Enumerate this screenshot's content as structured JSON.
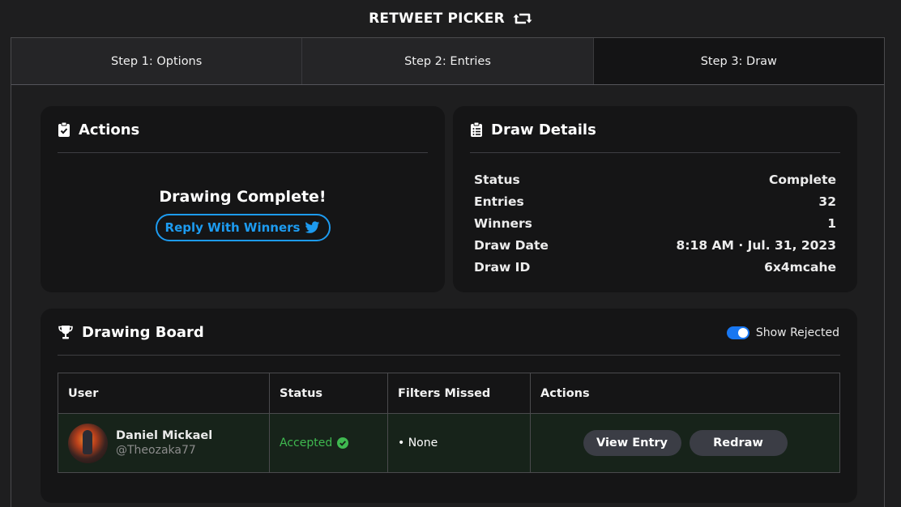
{
  "app": {
    "title": "RETWEET PICKER"
  },
  "steps": [
    {
      "label": "Step 1: Options"
    },
    {
      "label": "Step 2: Entries"
    },
    {
      "label": "Step 3: Draw"
    }
  ],
  "actions_card": {
    "title": "Actions",
    "message": "Drawing Complete!",
    "reply_button": "Reply With Winners"
  },
  "details_card": {
    "title": "Draw Details",
    "rows": [
      {
        "label": "Status",
        "value": "Complete"
      },
      {
        "label": "Entries",
        "value": "32"
      },
      {
        "label": "Winners",
        "value": "1"
      },
      {
        "label": "Draw Date",
        "value": "8:18 AM · Jul. 31, 2023"
      },
      {
        "label": "Draw ID",
        "value": "6x4mcahe"
      }
    ]
  },
  "board": {
    "title": "Drawing Board",
    "toggle_label": "Show Rejected",
    "toggle_on": true,
    "columns": [
      "User",
      "Status",
      "Filters Missed",
      "Actions"
    ],
    "rows": [
      {
        "name": "Daniel Mickael",
        "handle": "@Theozaka77",
        "status": "Accepted",
        "filters_missed": "• None",
        "view_label": "View Entry",
        "redraw_label": "Redraw"
      }
    ]
  },
  "colors": {
    "accent_twitter": "#1d9bf0",
    "accepted_green": "#3fb950",
    "toggle_blue": "#1877f2"
  },
  "icons": {
    "title": "retweet-icon",
    "actions": "clipboard-check-icon",
    "details": "clipboard-list-icon",
    "board": "trophy-icon",
    "reply": "twitter-bird-icon",
    "status": "check-circle-icon"
  }
}
